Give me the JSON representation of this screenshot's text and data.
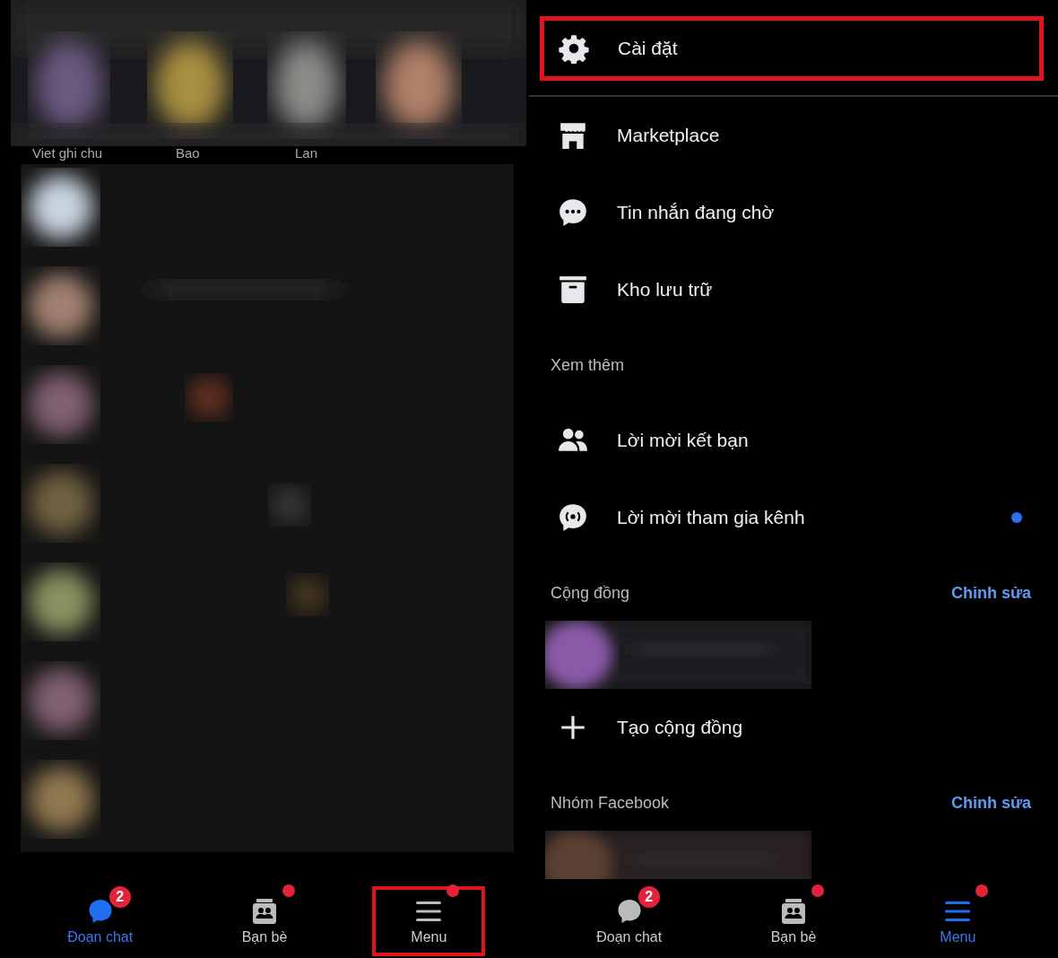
{
  "left_panel": {
    "stories": [
      {
        "label": "Viet ghi chu"
      },
      {
        "label": "Bao"
      },
      {
        "label": "Lan"
      }
    ],
    "bottom_nav": [
      {
        "label": "Đoạn chat",
        "kind": "chat",
        "selected": true,
        "badge": "2",
        "dot": false,
        "highlighted": false
      },
      {
        "label": "Bạn bè",
        "kind": "friends",
        "selected": false,
        "dot": true,
        "highlighted": false
      },
      {
        "label": "Menu",
        "kind": "menu",
        "selected": false,
        "dot": true,
        "highlighted": true
      }
    ]
  },
  "right_panel": {
    "settings": {
      "label": "Cài đặt",
      "kind": "gear",
      "highlighted": true
    },
    "items": [
      {
        "kind": "store",
        "label": "Marketplace",
        "dot": false
      },
      {
        "kind": "chat-dots",
        "label": "Tin nhắn đang chờ",
        "dot": false
      },
      {
        "kind": "archive",
        "label": "Kho lưu trữ",
        "dot": false
      }
    ],
    "sections": [
      {
        "title": "Xem thêm",
        "rows": [
          {
            "kind": "people",
            "label": "Lời mời kết bạn",
            "dot": false
          },
          {
            "kind": "broadcast",
            "label": "Lời mời tham gia kênh",
            "dot": true
          }
        ]
      },
      {
        "title": "Cộng đồng",
        "action": "Chỉnh sửa",
        "rows": [
          {
            "kind": "picture"
          },
          {
            "kind": "plus",
            "label": "Tạo cộng đồng",
            "dot": false
          }
        ]
      },
      {
        "title": "Nhóm Facebook",
        "action": "Chỉnh sửa",
        "rows": [
          {
            "kind": "picture"
          }
        ]
      }
    ],
    "bottom_nav": [
      {
        "label": "Đoạn chat",
        "kind": "chat",
        "selected": false,
        "badge": "2",
        "dot": false,
        "highlighted": false
      },
      {
        "label": "Bạn bè",
        "kind": "friends",
        "selected": false,
        "dot": true,
        "highlighted": false
      },
      {
        "label": "Menu",
        "kind": "menu",
        "selected": true,
        "dot": true,
        "highlighted": false
      }
    ]
  }
}
